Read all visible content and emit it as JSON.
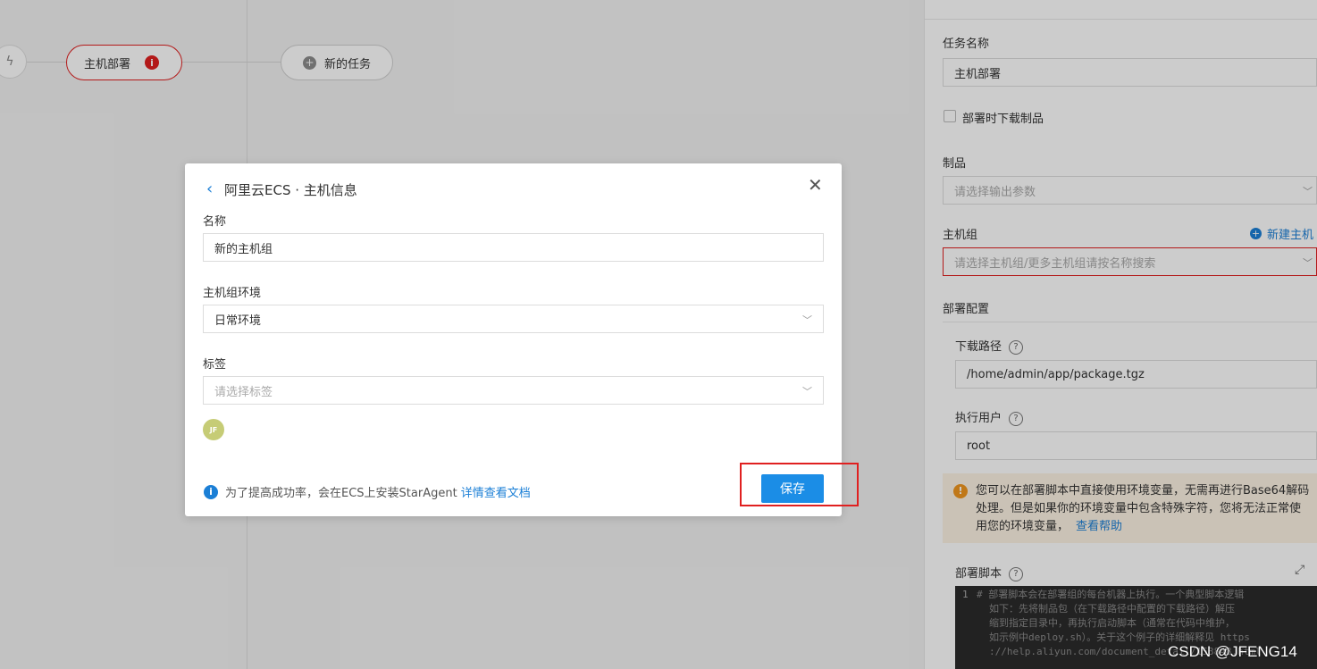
{
  "pipeline": {
    "host_node_label": "主机部署",
    "host_node_error": "i",
    "new_task_label": "新的任务",
    "trigger_icon": "lightning-icon"
  },
  "panel": {
    "task_name_label": "任务名称",
    "task_name_value": "主机部署",
    "download_artifact_label": "部署时下载制品",
    "artifact_label": "制品",
    "artifact_placeholder": "请选择输出参数",
    "host_group_label": "主机组",
    "new_host_group_link": "新建主机",
    "host_group_placeholder": "请选择主机组/更多主机组请按名称搜索",
    "deploy_config_label": "部署配置",
    "download_path_label": "下载路径",
    "download_path_value": "/home/admin/app/package.tgz",
    "exec_user_label": "执行用户",
    "exec_user_value": "root",
    "notice_text": "您可以在部署脚本中直接使用环境变量，无需再进行Base64解码处理。但是如果你的环境变量中包含特殊字符，您将无法正常使用您的环境变量，",
    "notice_link": "查看帮助",
    "script_label": "部署脚本",
    "code_line_number": "1",
    "code_lines": [
      "# 部署脚本会在部署组的每台机器上执行。一个典型脚本逻辑",
      "如下：先将制品包（在下载路径中配置的下载路径）解压",
      "缩到指定目录中，再执行启动脚本（通常在代码中维护，",
      "如示例中deploy.sh）。关于这个例子的详细解释见 https",
      "://help.aliyun.com/document_detail/153848.html"
    ]
  },
  "modal": {
    "title": "阿里云ECS · 主机信息",
    "name_label": "名称",
    "name_value": "新的主机组",
    "env_label": "主机组环境",
    "env_value": "日常环境",
    "tag_label": "标签",
    "tag_placeholder": "请选择标签",
    "avatar_initials": "JF",
    "tip_text": "为了提高成功率，会在ECS上安装StarAgent",
    "tip_link": "详情查看文档",
    "save_label": "保存"
  },
  "watermark": "CSDN @JFENG14",
  "colors": {
    "accent": "#1b8de6",
    "error": "#e02020",
    "warning": "#f0961e"
  }
}
